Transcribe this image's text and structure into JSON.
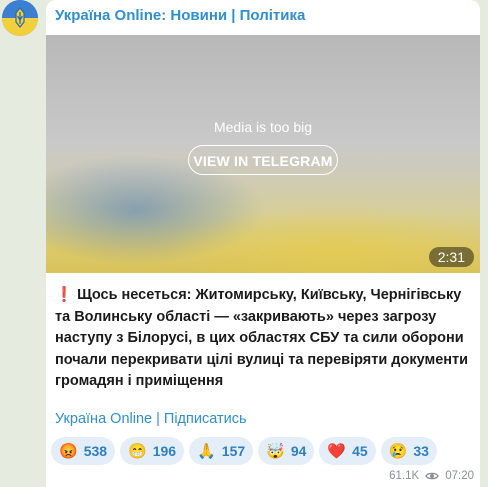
{
  "channel": {
    "title": "Україна Online: Новини | Політика"
  },
  "media": {
    "notice": "Media is too big",
    "button_label": "VIEW IN TELEGRAM",
    "duration": "2:31"
  },
  "post": {
    "marker": "❗",
    "text": "Щось несеться: Житомирську, Київську, Чернігівську та Волинську області — «закривають» через загрозу наступу з Білорусі, в цих областях СБУ та сили оборони почали перекривати цілі вулиці та перевіряти документи громадян і приміщення",
    "signature": "Україна Online | Підписатись"
  },
  "reactions": [
    {
      "icon": "angry-face-icon",
      "emoji": "😡",
      "count": "538"
    },
    {
      "icon": "grinning-face-icon",
      "emoji": "😁",
      "count": "196"
    },
    {
      "icon": "praying-hands-icon",
      "emoji": "🙏",
      "count": "157"
    },
    {
      "icon": "exploding-head-icon",
      "emoji": "🤯",
      "count": "94"
    },
    {
      "icon": "heart-icon",
      "emoji": "❤️",
      "count": "45"
    },
    {
      "icon": "crying-face-icon",
      "emoji": "😢",
      "count": "33"
    }
  ],
  "meta": {
    "views": "61.1K",
    "time": "07:20"
  },
  "colors": {
    "accent": "#2f8fcf",
    "background": "#e5ecdf",
    "reaction_bg": "#e4eef8"
  }
}
